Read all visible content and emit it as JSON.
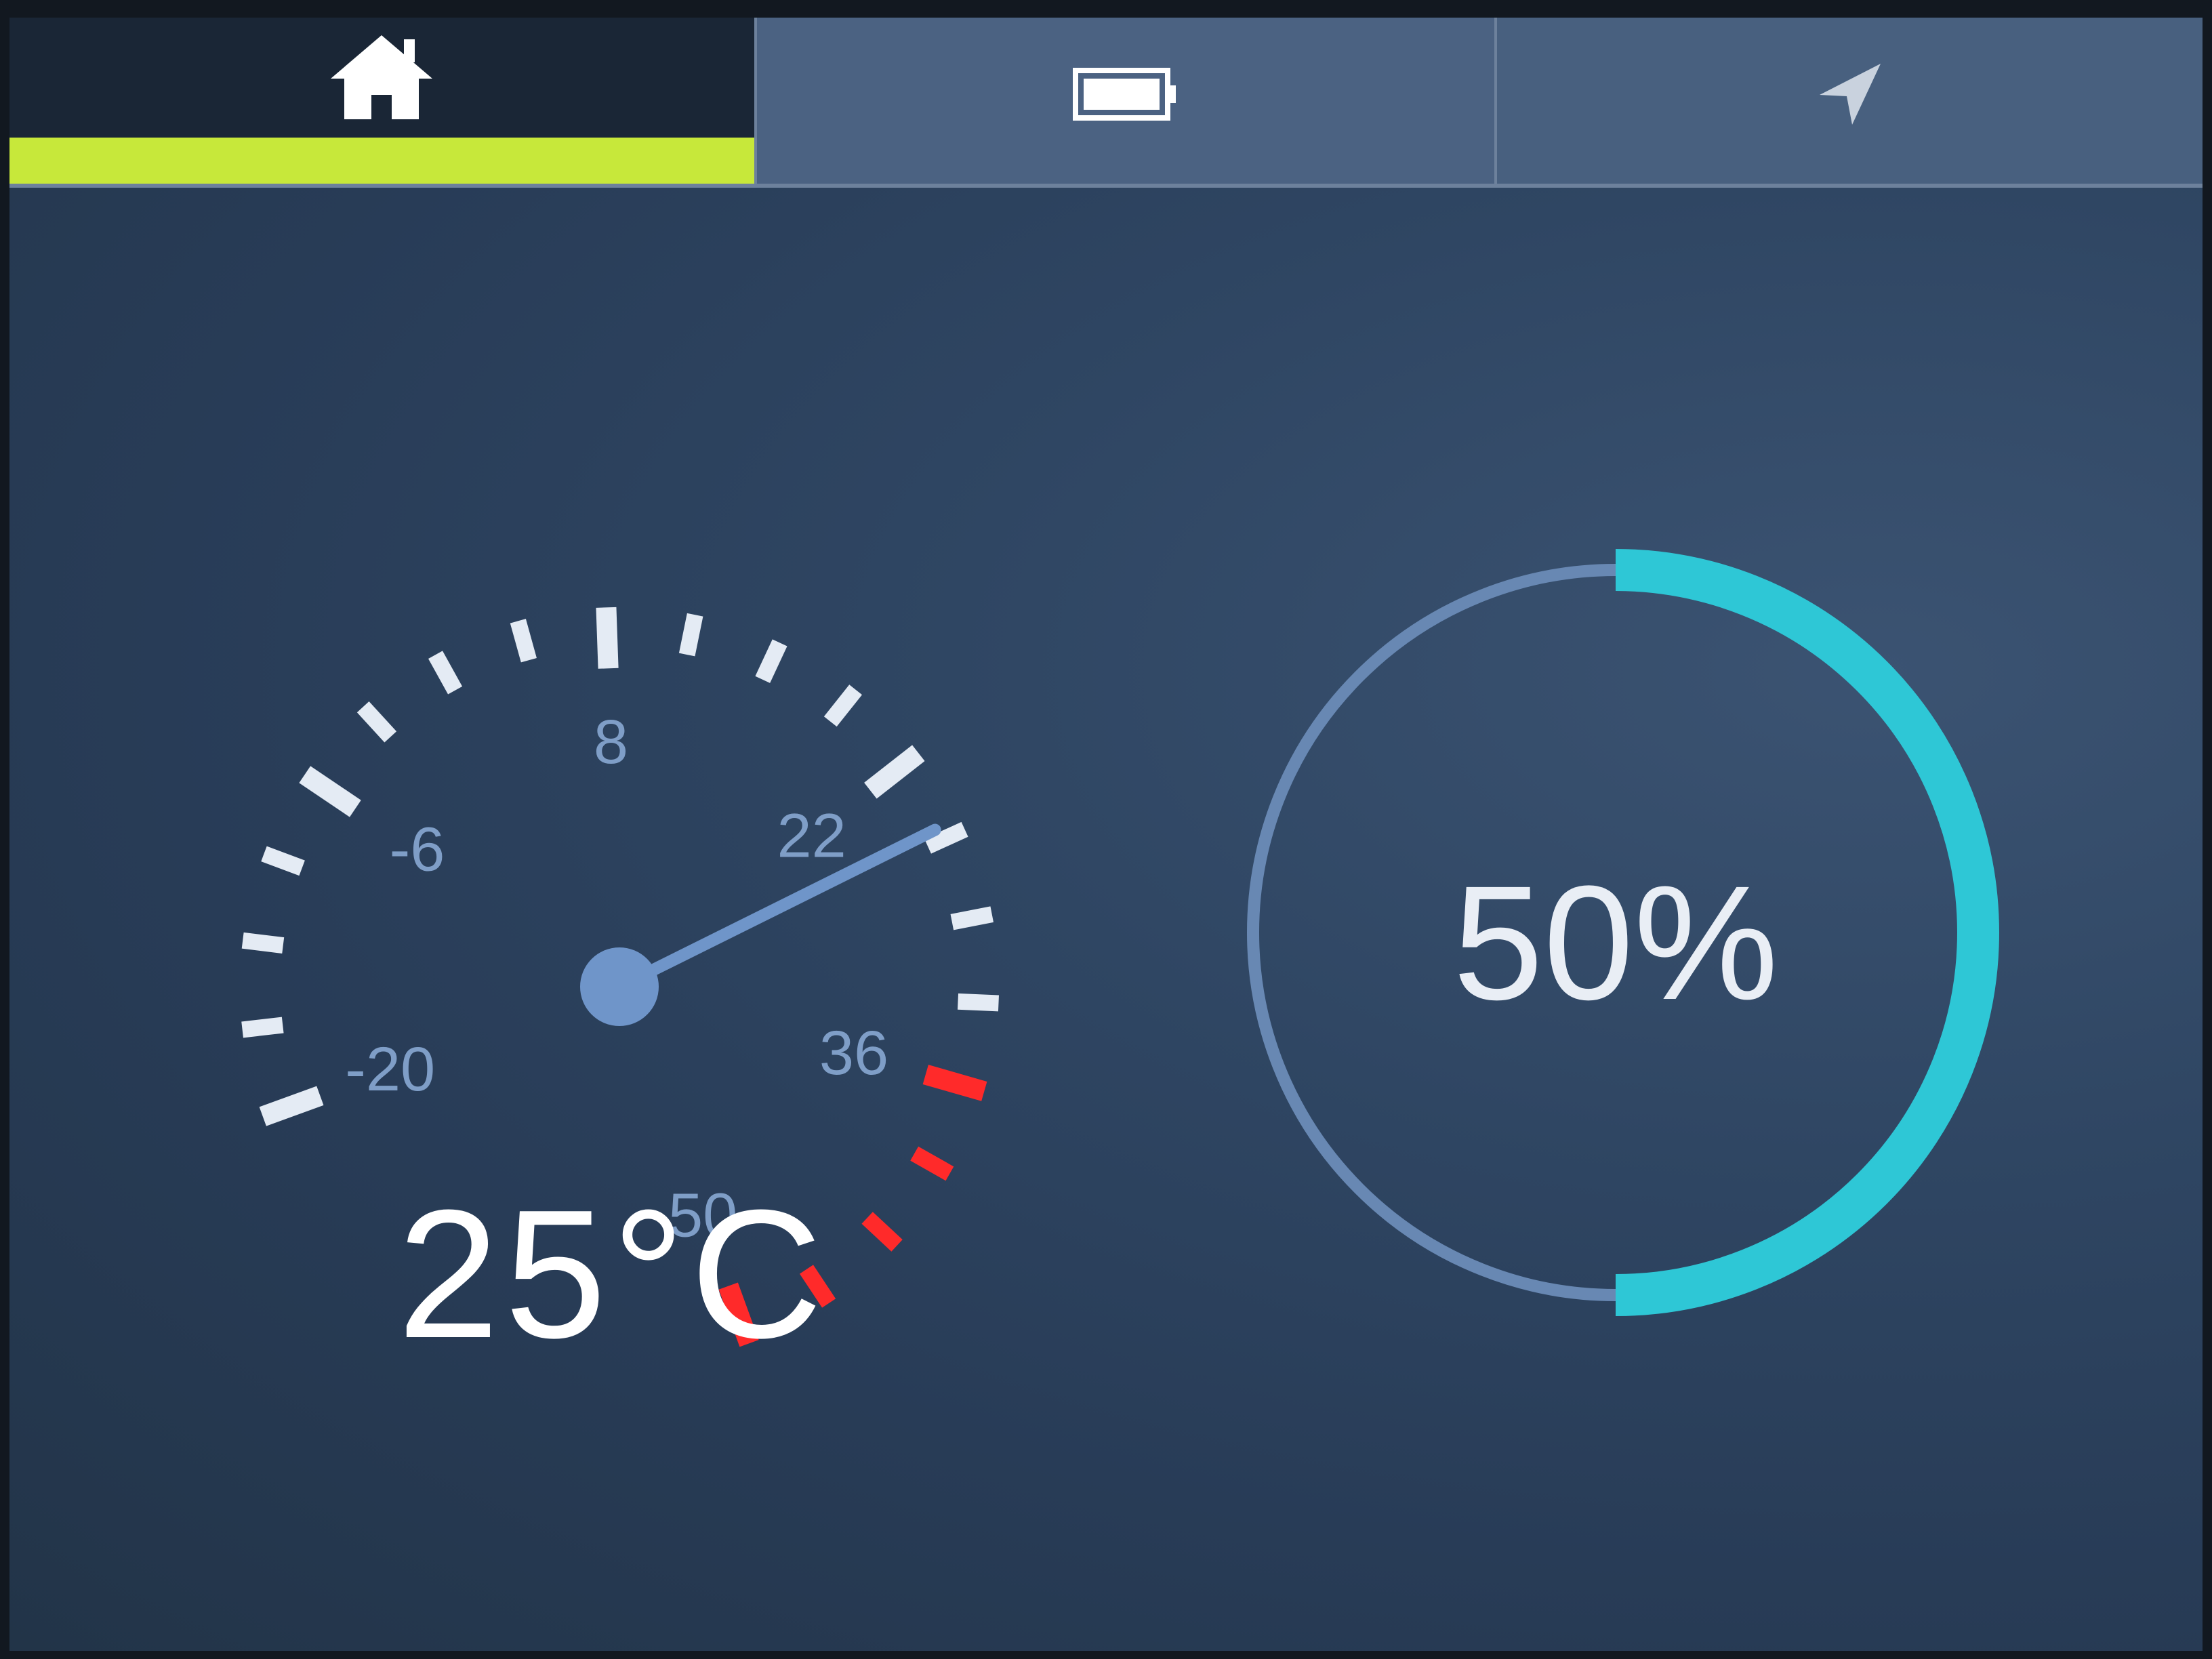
{
  "tabs": [
    {
      "icon": "home-icon",
      "selected": true
    },
    {
      "icon": "battery-icon",
      "selected": false
    },
    {
      "icon": "navigation-arrow-icon",
      "selected": false
    }
  ],
  "colors": {
    "accent_indicator": "#c7e83a",
    "progress_ring": "#2ec7d6",
    "gauge_warning": "#ff2a2a"
  },
  "temperature_gauge": {
    "tick_labels": [
      "-20",
      "-6",
      "8",
      "22",
      "36",
      "50"
    ],
    "min": -20,
    "max": 50,
    "needle_value": 25,
    "warning_from": 36,
    "readout": "25°C"
  },
  "progress": {
    "value": 0.5,
    "label": "50%"
  }
}
